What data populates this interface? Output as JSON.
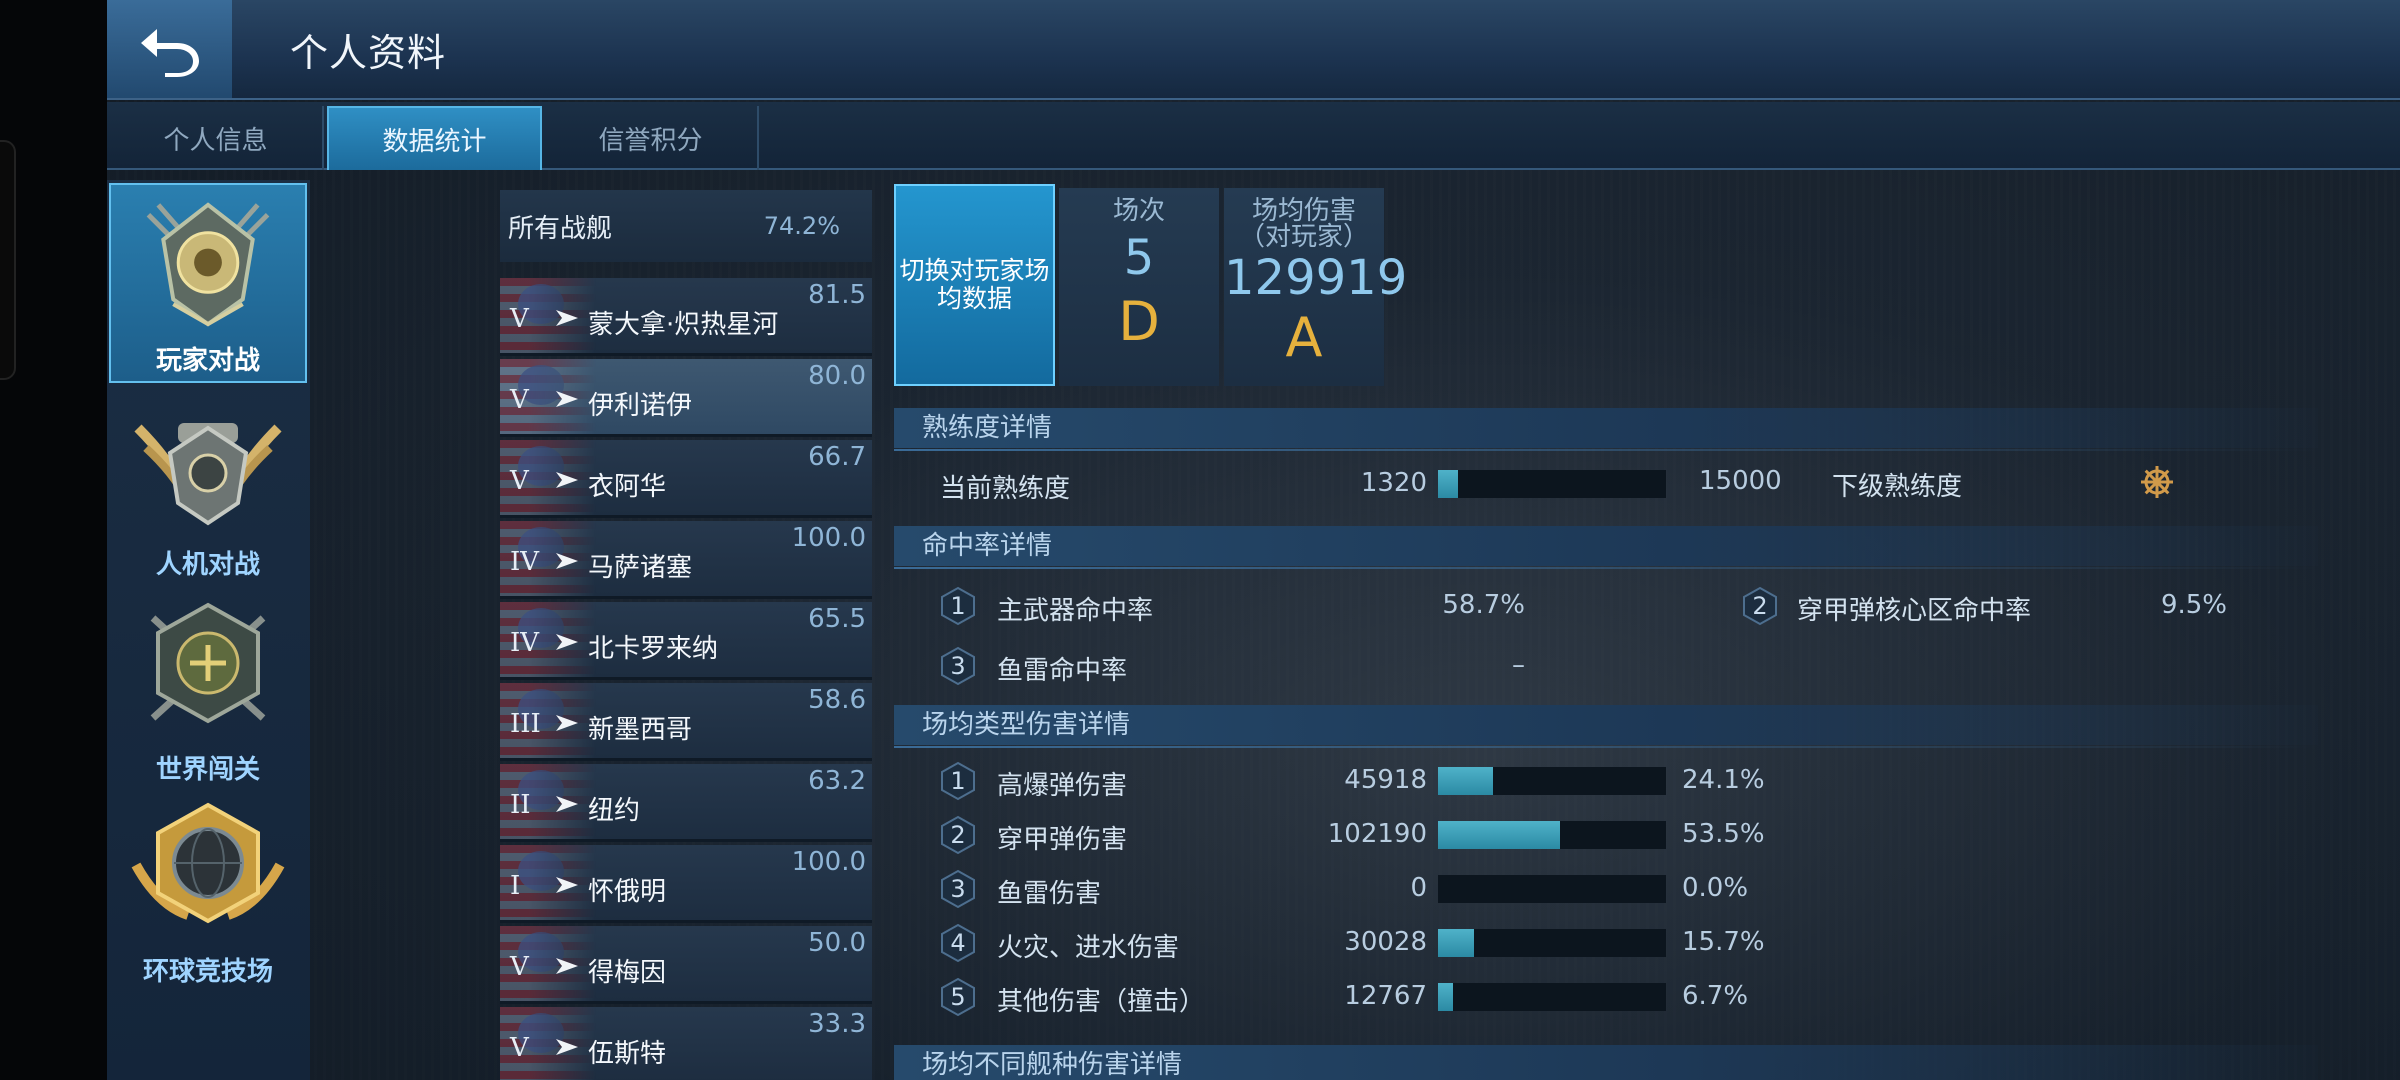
{
  "header": {
    "title": "个人资料"
  },
  "tabs": [
    {
      "label": "个人信息"
    },
    {
      "label": "数据统计"
    },
    {
      "label": "信誉积分"
    }
  ],
  "modes": [
    {
      "label": "玩家对战"
    },
    {
      "label": "人机对战"
    },
    {
      "label": "世界闯关"
    },
    {
      "label": "环球竞技场"
    }
  ],
  "ships": {
    "all": {
      "name": "所有战舰",
      "pct": "74.2%"
    },
    "items": [
      {
        "tier": "V",
        "name": "蒙大拿·炽热星河",
        "score": "81.5"
      },
      {
        "tier": "V",
        "name": "伊利诺伊",
        "score": "80.0"
      },
      {
        "tier": "V",
        "name": "衣阿华",
        "score": "66.7"
      },
      {
        "tier": "IV",
        "name": "马萨诸塞",
        "score": "100.0"
      },
      {
        "tier": "IV",
        "name": "北卡罗来纳",
        "score": "65.5"
      },
      {
        "tier": "III",
        "name": "新墨西哥",
        "score": "58.6"
      },
      {
        "tier": "II",
        "name": "纽约",
        "score": "63.2"
      },
      {
        "tier": "I",
        "name": "怀俄明",
        "score": "100.0"
      },
      {
        "tier": "V",
        "name": "得梅因",
        "score": "50.0"
      },
      {
        "tier": "V",
        "name": "伍斯特",
        "score": "33.3"
      }
    ]
  },
  "summary": {
    "switch_label": "切换对玩家场均数据",
    "matches": {
      "label": "场次",
      "value": "5",
      "grade": "D"
    },
    "avg_damage": {
      "label": "场均伤害（对玩家）",
      "value": "129919",
      "grade": "A"
    }
  },
  "proficiency": {
    "title": "熟练度详情",
    "current_label": "当前熟练度",
    "current": "1320",
    "target": "15000",
    "progress": 0.088,
    "next_label": "下级熟练度"
  },
  "hit_rate": {
    "title": "命中率详情",
    "items": [
      {
        "num": "1",
        "label": "主武器命中率",
        "value": "58.7%"
      },
      {
        "num": "2",
        "label": "穿甲弹核心区命中率",
        "value": "9.5%"
      },
      {
        "num": "3",
        "label": "鱼雷命中率",
        "value": "–"
      }
    ]
  },
  "damage_types": {
    "title": "场均类型伤害详情",
    "items": [
      {
        "num": "1",
        "label": "高爆弹伤害",
        "value": "45918",
        "pct": "24.1%",
        "ratio": 0.241
      },
      {
        "num": "2",
        "label": "穿甲弹伤害",
        "value": "102190",
        "pct": "53.5%",
        "ratio": 0.535
      },
      {
        "num": "3",
        "label": "鱼雷伤害",
        "value": "0",
        "pct": "0.0%",
        "ratio": 0.0
      },
      {
        "num": "4",
        "label": "火灾、进水伤害",
        "value": "30028",
        "pct": "15.7%",
        "ratio": 0.157
      },
      {
        "num": "5",
        "label": "其他伤害（撞击）",
        "value": "12767",
        "pct": "6.7%",
        "ratio": 0.067
      }
    ]
  },
  "ship_type_damage": {
    "title": "场均不同舰种伤害详情"
  },
  "colors": {
    "accent": "#2496cf",
    "grade": "#e6b13d",
    "bar_fill": "#3a9fba",
    "bar_bg": "#0c151e"
  },
  "icons": {
    "back": "undo-arrow-icon",
    "helm": "ship-wheel-icon",
    "ship_type": "battleship-type-icon"
  }
}
